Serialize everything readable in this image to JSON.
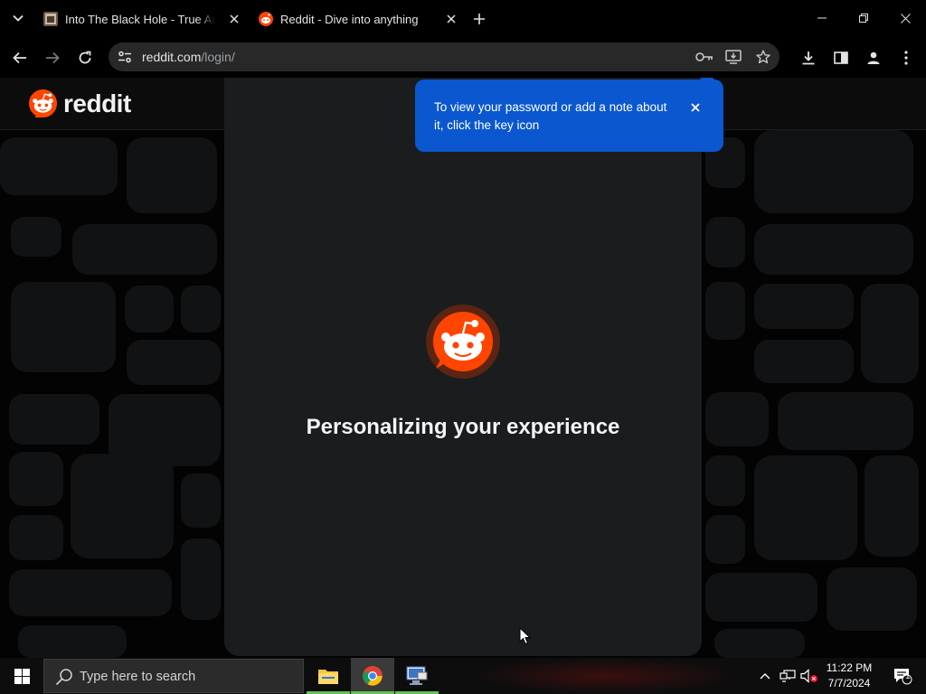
{
  "browser": {
    "tabs": [
      {
        "title": "Into The Black Hole - True Amo",
        "active": false
      },
      {
        "title": "Reddit - Dive into anything",
        "active": true
      }
    ],
    "address": {
      "host": "reddit.com",
      "path": "/login/"
    }
  },
  "page": {
    "logo_text": "reddit",
    "loading_text": "Personalizing your experience"
  },
  "password_bubble": {
    "message": "To view your password or add a note about it, click the key icon"
  },
  "taskbar": {
    "search_placeholder": "Type here to search",
    "time": "11:22 PM",
    "date": "7/7/2024",
    "notification_count": "1"
  },
  "colors": {
    "reddit_orange": "#ff4500",
    "bubble_blue": "#0b57d0",
    "modal_bg": "#1a1c1e"
  }
}
